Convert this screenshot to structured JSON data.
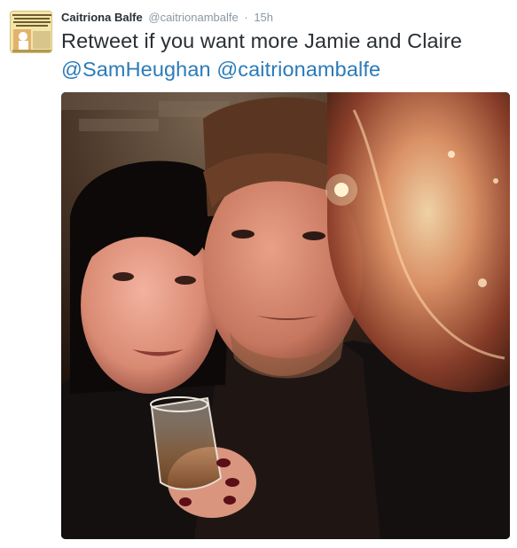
{
  "tweet": {
    "author_name": "Caitriona Balfe",
    "author_handle": "@caitrionambalfe",
    "separator": "·",
    "timestamp": "15h",
    "text_part1": "Retweet if you want more Jamie and Claire ",
    "mention1": "@SamHeughan",
    "text_part2": " ",
    "mention2": "@caitrionambalfe",
    "avatar_icon": "profile-picture-icon",
    "media_icon": "selfie-photo"
  },
  "colors": {
    "name": "#292f33",
    "meta": "#8899a6",
    "link": "#2b7bb9",
    "text": "#292f33"
  }
}
